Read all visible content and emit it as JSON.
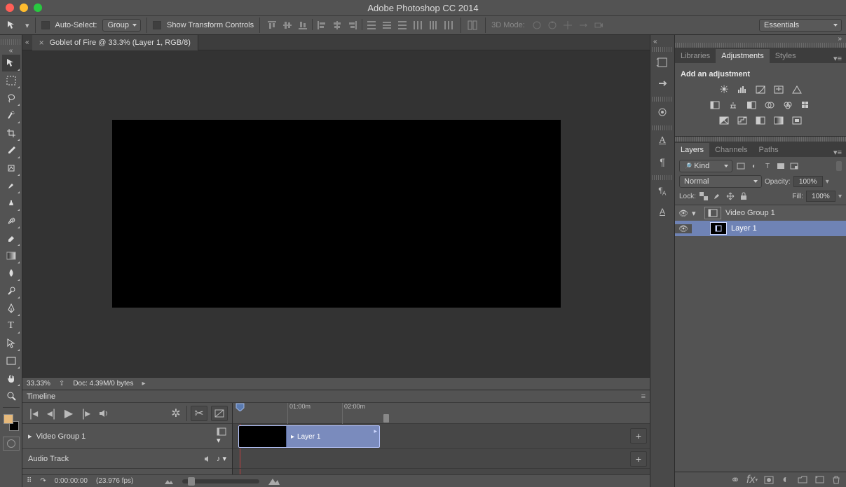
{
  "app": {
    "title": "Adobe Photoshop CC 2014"
  },
  "options": {
    "auto_select": "Auto-Select:",
    "group": "Group",
    "show_transform": "Show Transform Controls",
    "mode3d": "3D Mode:"
  },
  "workspace": {
    "name": "Essentials"
  },
  "document": {
    "tab_label": "Goblet of Fire @ 33.3% (Layer 1, RGB/8)",
    "zoom": "33.33%",
    "doc_info": "Doc: 4.39M/0 bytes"
  },
  "timeline": {
    "title": "Timeline",
    "marks": {
      "m1": "01:00m",
      "m2": "02:00m"
    },
    "video_group": "Video Group 1",
    "audio_track": "Audio Track",
    "clip_label": "Layer 1",
    "timecode": "0:00:00:00",
    "fps": "(23.976 fps)"
  },
  "panels": {
    "libraries": "Libraries",
    "adjustments": "Adjustments",
    "styles": "Styles",
    "add_adjustment": "Add an adjustment",
    "layers_tab": "Layers",
    "channels_tab": "Channels",
    "paths_tab": "Paths",
    "kind_label": "Kind",
    "blend_mode": "Normal",
    "opacity_label": "Opacity:",
    "opacity_value": "100%",
    "lock_label": "Lock:",
    "fill_label": "Fill:",
    "fill_value": "100%",
    "group_name": "Video Group 1",
    "layer_name": "Layer 1"
  }
}
